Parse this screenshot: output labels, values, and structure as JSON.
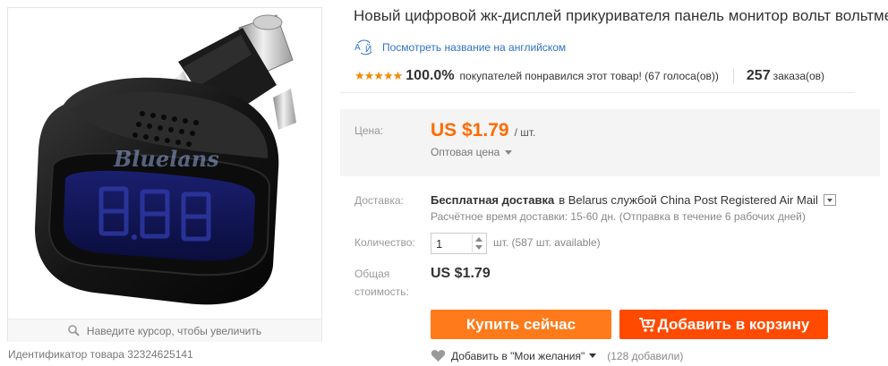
{
  "product": {
    "title": "Новый цифровой жк-дисплей прикуривателя панель монитор вольт вольтметр",
    "translate_link": "Посмотреть название на английском",
    "image_watermark": "Bluelans",
    "display_digits": "888",
    "zoom_hint": "Наведите курсор, чтобы увеличить",
    "product_id": "Идентификатор товара 32324625141"
  },
  "rating": {
    "stars": 5,
    "star_glyphs": "★★★★★",
    "percent": "100.0%",
    "text": "покупателей понравился этот товар! (67 голоса(ов))",
    "orders_count": "257",
    "orders_label": "заказа(ов)"
  },
  "price": {
    "label": "Цена:",
    "amount": "US $1.79",
    "unit": "/ шт.",
    "wholesale": "Оптовая цена"
  },
  "shipping": {
    "label": "Доставка:",
    "free": "Бесплатная доставка",
    "destination": "в  Belarus службой China Post Registered Air Mail",
    "estimate": "Расчётное время доставки: 15-60 дн. (Отправка в течение 6 рабочих дней)"
  },
  "quantity": {
    "label": "Количество:",
    "value": "1",
    "available": "шт. (587 шт. available)"
  },
  "total": {
    "label_line1": "Общая",
    "label_line2": "стоимость:",
    "value": "US $1.79"
  },
  "actions": {
    "buy_now": "Купить сейчас",
    "add_to_cart": "Добавить в корзину"
  },
  "wishlist": {
    "label": "Добавить в \"Мои желания\"",
    "count": "(128 добавили)"
  },
  "colors": {
    "accent_price": "#ff6a00",
    "buy_button": "#ff7a1a",
    "cart_button": "#ff4a00",
    "link": "#2e72c8",
    "star": "#f28a00"
  },
  "icons": [
    "magnifier-icon",
    "translate-icon",
    "star-icon",
    "caret-down-icon",
    "cart-icon",
    "heart-icon"
  ]
}
